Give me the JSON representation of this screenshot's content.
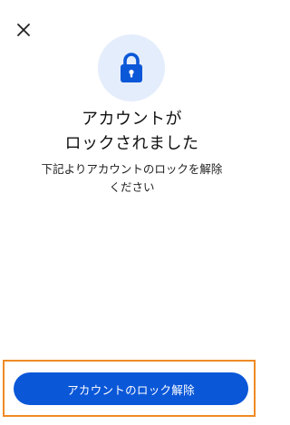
{
  "header": {
    "close_icon": "close-icon"
  },
  "hero": {
    "icon": "lock-icon",
    "badge_bg": "#e4edfb",
    "icon_color": "#0a57d8"
  },
  "message": {
    "title_line1": "アカウントが",
    "title_line2": "ロックされました",
    "desc_line1": "下記よりアカウントのロックを解除",
    "desc_line2": "ください"
  },
  "footer": {
    "unlock_button_label": "アカウントのロック解除",
    "button_color": "#0a57d8",
    "highlight_color": "#ef8a24"
  }
}
